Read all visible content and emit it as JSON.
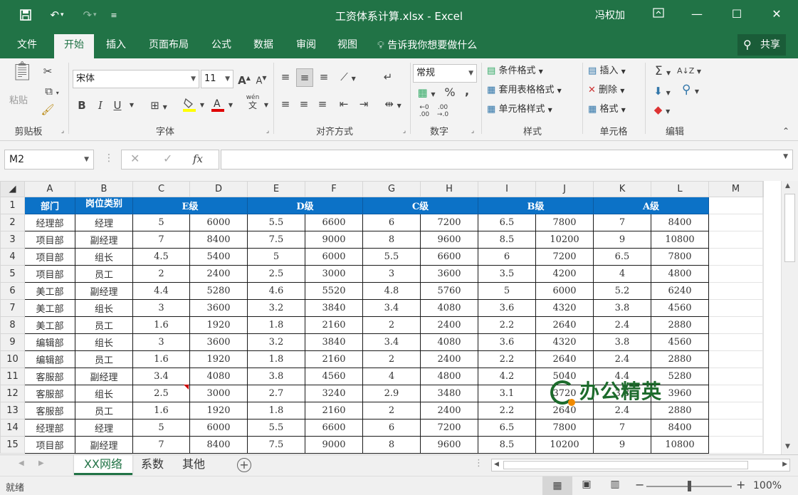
{
  "titlebar": {
    "title": "工资体系计算.xlsx  -  Excel",
    "user": "冯权加"
  },
  "tabs": [
    "文件",
    "开始",
    "插入",
    "页面布局",
    "公式",
    "数据",
    "审阅",
    "视图"
  ],
  "tell_me": "告诉我你想要做什么",
  "share": "共享",
  "ribbon": {
    "clipboard": {
      "paste": "粘贴",
      "group": "剪贴板"
    },
    "font": {
      "name": "宋体",
      "size": "11",
      "group": "字体",
      "bold": "B",
      "italic": "I",
      "underline": "U",
      "grow": "A",
      "shrink": "A",
      "phonetic_top": "wén",
      "phonetic_bottom": "文"
    },
    "alignment": {
      "group": "对齐方式"
    },
    "number": {
      "format": "常规",
      "group": "数字",
      "percent": "%",
      "comma": ","
    },
    "styles": {
      "conditional": "条件格式",
      "table": "套用表格格式",
      "cell": "单元格样式",
      "group": "样式"
    },
    "cells": {
      "insert": "插入",
      "delete": "删除",
      "format": "格式",
      "group": "单元格"
    },
    "editing": {
      "group": "编辑",
      "sum": "Σ"
    }
  },
  "formula": {
    "name_box": "M2",
    "fx": "fx",
    "value": ""
  },
  "columns": [
    "A",
    "B",
    "C",
    "D",
    "E",
    "F",
    "G",
    "H",
    "I",
    "J",
    "K",
    "L",
    "M"
  ],
  "header_row": {
    "a": "部门",
    "b": "岗位类别",
    "e": "E级",
    "d": "D级",
    "c": "C级",
    "b_grade": "B级",
    "a_grade": "A级"
  },
  "rows": [
    [
      "经理部",
      "经理",
      "5",
      "6000",
      "5.5",
      "6600",
      "6",
      "7200",
      "6.5",
      "7800",
      "7",
      "8400"
    ],
    [
      "项目部",
      "副经理",
      "7",
      "8400",
      "7.5",
      "9000",
      "8",
      "9600",
      "8.5",
      "10200",
      "9",
      "10800"
    ],
    [
      "项目部",
      "组长",
      "4.5",
      "5400",
      "5",
      "6000",
      "5.5",
      "6600",
      "6",
      "7200",
      "6.5",
      "7800"
    ],
    [
      "项目部",
      "员工",
      "2",
      "2400",
      "2.5",
      "3000",
      "3",
      "3600",
      "3.5",
      "4200",
      "4",
      "4800"
    ],
    [
      "美工部",
      "副经理",
      "4.4",
      "5280",
      "4.6",
      "5520",
      "4.8",
      "5760",
      "5",
      "6000",
      "5.2",
      "6240"
    ],
    [
      "美工部",
      "组长",
      "3",
      "3600",
      "3.2",
      "3840",
      "3.4",
      "4080",
      "3.6",
      "4320",
      "3.8",
      "4560"
    ],
    [
      "美工部",
      "员工",
      "1.6",
      "1920",
      "1.8",
      "2160",
      "2",
      "2400",
      "2.2",
      "2640",
      "2.4",
      "2880"
    ],
    [
      "编辑部",
      "组长",
      "3",
      "3600",
      "3.2",
      "3840",
      "3.4",
      "4080",
      "3.6",
      "4320",
      "3.8",
      "4560"
    ],
    [
      "编辑部",
      "员工",
      "1.6",
      "1920",
      "1.8",
      "2160",
      "2",
      "2400",
      "2.2",
      "2640",
      "2.4",
      "2880"
    ],
    [
      "客服部",
      "副经理",
      "3.4",
      "4080",
      "3.8",
      "4560",
      "4",
      "4800",
      "4.2",
      "5040",
      "4.4",
      "5280"
    ],
    [
      "客服部",
      "组长",
      "2.5",
      "3000",
      "2.7",
      "3240",
      "2.9",
      "3480",
      "3.1",
      "3720",
      "3.3",
      "3960"
    ],
    [
      "客服部",
      "员工",
      "1.6",
      "1920",
      "1.8",
      "2160",
      "2",
      "2400",
      "2.2",
      "2640",
      "2.4",
      "2880"
    ],
    [
      "经理部",
      "经理",
      "5",
      "6000",
      "5.5",
      "6600",
      "6",
      "7200",
      "6.5",
      "7800",
      "7",
      "8400"
    ],
    [
      "项目部",
      "副经理",
      "7",
      "8400",
      "7.5",
      "9000",
      "8",
      "9600",
      "8.5",
      "10200",
      "9",
      "10800"
    ]
  ],
  "sheets": [
    "XX网络",
    "系数",
    "其他"
  ],
  "status": {
    "ready": "就绪",
    "zoom": "100%"
  },
  "watermark": "办公精英"
}
